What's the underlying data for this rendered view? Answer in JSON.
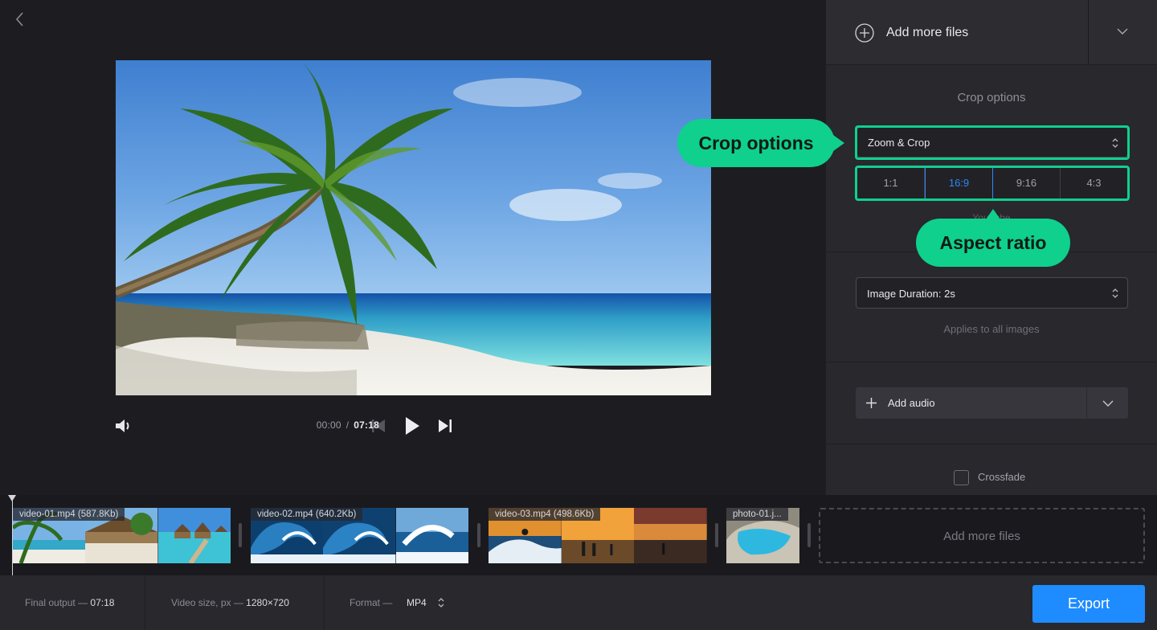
{
  "player": {
    "current_time": "00:00",
    "separator": "/",
    "total_time": "07:18"
  },
  "panel": {
    "add_more_files": "Add more files",
    "crop_title": "Crop options",
    "crop_mode": "Zoom & Crop",
    "ratios": [
      {
        "label": "1:1",
        "active": false
      },
      {
        "label": "16:9",
        "active": true
      },
      {
        "label": "9:16",
        "active": false
      },
      {
        "label": "4:3",
        "active": false
      }
    ],
    "ratio_hint": "YouTube",
    "image_duration": "Image Duration: 2s",
    "image_duration_hint": "Applies to all images",
    "add_audio": "Add audio",
    "crossfade": "Crossfade"
  },
  "callouts": {
    "crop": "Crop options",
    "aspect": "Aspect ratio"
  },
  "timeline": {
    "clips": [
      {
        "name": "video-01.mp4 (587.8Kb)",
        "thumbs": [
          "palm-beach",
          "beach-hut",
          "overwater-villas"
        ]
      },
      {
        "name": "video-02.mp4 (640.2Kb)",
        "thumbs": [
          "wave",
          "wave",
          "wave-surf"
        ]
      },
      {
        "name": "video-03.mp4 (498.6Kb)",
        "thumbs": [
          "sunset-surf",
          "sunset-people",
          "sunset-sky"
        ]
      },
      {
        "name": "photo-01.j...",
        "thumbs": [
          "cove"
        ]
      }
    ],
    "add_more_files": "Add more files"
  },
  "footer": {
    "final_output_label": "Final output —",
    "final_output_value": "07:18",
    "video_size_label": "Video size, px —",
    "video_size_value": "1280×720",
    "format_label": "Format —",
    "format_value": "MP4",
    "export": "Export"
  },
  "colors": {
    "accent": "#1e8bff",
    "highlight": "#0fd08d",
    "active_ratio": "#2f86ff"
  }
}
